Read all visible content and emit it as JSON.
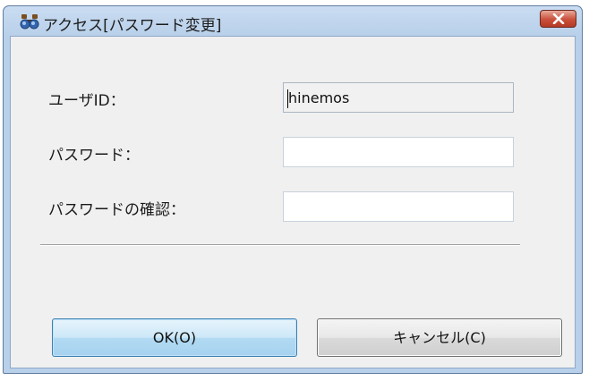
{
  "window": {
    "title": "アクセス[パスワード変更]",
    "icon": "binoculars-icon",
    "close_icon": "close-icon",
    "close_color": "#c9503a"
  },
  "form": {
    "user_id_label": "ユーザID：",
    "user_id_value": "hinemos",
    "password_label": "パスワード：",
    "password_value": "",
    "confirm_label": "パスワードの確認：",
    "confirm_value": ""
  },
  "buttons": {
    "ok_label": "OK(O)",
    "cancel_label": "キャンセル(C)"
  },
  "colors": {
    "accent": "#3c7fb1",
    "frame": "#b8d0ea"
  }
}
